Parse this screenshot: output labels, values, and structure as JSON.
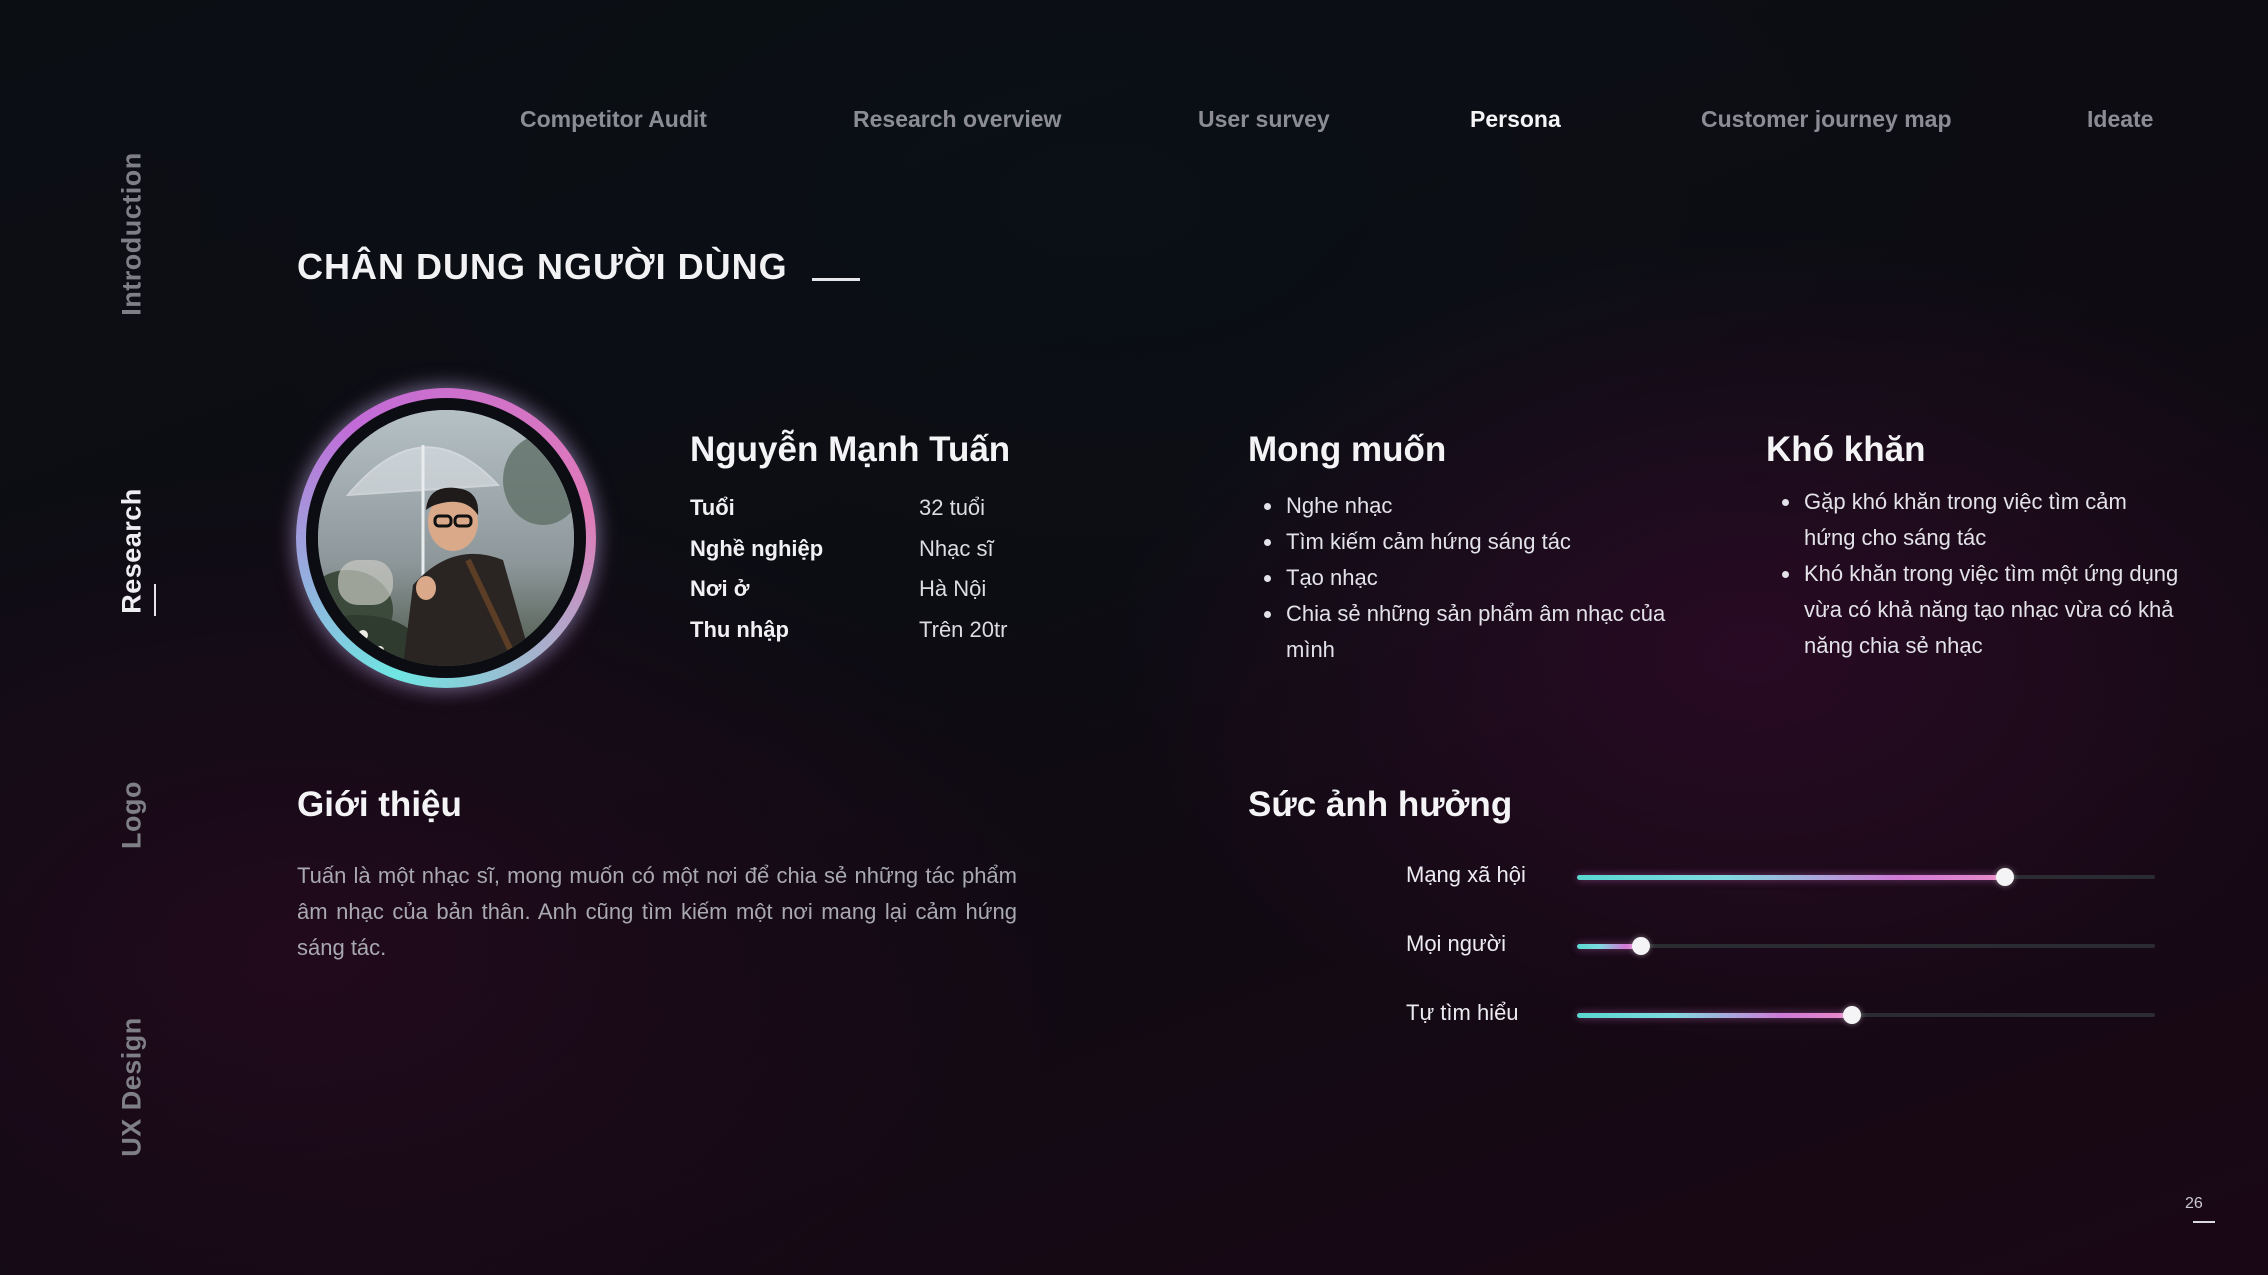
{
  "top_nav": [
    {
      "label": "Competitor Audit",
      "active": false
    },
    {
      "label": "Research overview",
      "active": false
    },
    {
      "label": "User survey",
      "active": false
    },
    {
      "label": "Persona",
      "active": true
    },
    {
      "label": "Customer journey map",
      "active": false
    },
    {
      "label": "Ideate",
      "active": false
    }
  ],
  "side_nav": [
    {
      "label": "Introduction",
      "active": false
    },
    {
      "label": "Research",
      "active": true
    },
    {
      "label": "Logo",
      "active": false
    },
    {
      "label": "UX Design",
      "active": false
    }
  ],
  "page_title": "CHÂN DUNG NGƯỜI DÙNG",
  "persona": {
    "name": "Nguyễn Mạnh Tuấn",
    "fields": [
      {
        "label": "Tuổi",
        "value": "32 tuổi"
      },
      {
        "label": "Nghề nghiệp",
        "value": "Nhạc sĩ"
      },
      {
        "label": "Nơi ở",
        "value": "Hà Nội"
      },
      {
        "label": "Thu nhập",
        "value": "Trên 20tr"
      }
    ]
  },
  "desires": {
    "title": "Mong muốn",
    "items": [
      "Nghe nhạc",
      "Tìm kiếm cảm hứng sáng tác",
      "Tạo nhạc",
      "Chia sẻ những sản phẩm âm nhạc của mình"
    ]
  },
  "difficulties": {
    "title": "Khó khăn",
    "items": [
      "Gặp khó khăn trong việc tìm cảm hứng cho sáng tác",
      "Khó khăn trong việc tìm một ứng dụng vừa có khả năng tạo nhạc vừa có khả năng chia sẻ nhạc"
    ]
  },
  "intro": {
    "title": "Giới thiệu",
    "text": "Tuấn là một nhạc sĩ, mong muốn có một nơi để chia sẻ những tác phẩm âm nhạc của bản thân. Anh cũng tìm kiếm một nơi mang lại cảm hứng sáng tác."
  },
  "influence": {
    "title": "Sức ảnh hưởng",
    "items": [
      {
        "label": "Mạng xã hội",
        "level": 0.74
      },
      {
        "label": "Mọi người",
        "level": 0.11
      },
      {
        "label": "Tự tìm hiểu",
        "level": 0.475
      }
    ]
  },
  "page_number": "26",
  "colors": {
    "accent_cyan": "#6fe6e2",
    "accent_pink": "#e07ab8",
    "active_text": "#f4f4f6",
    "muted_text": "#8c8c95"
  }
}
